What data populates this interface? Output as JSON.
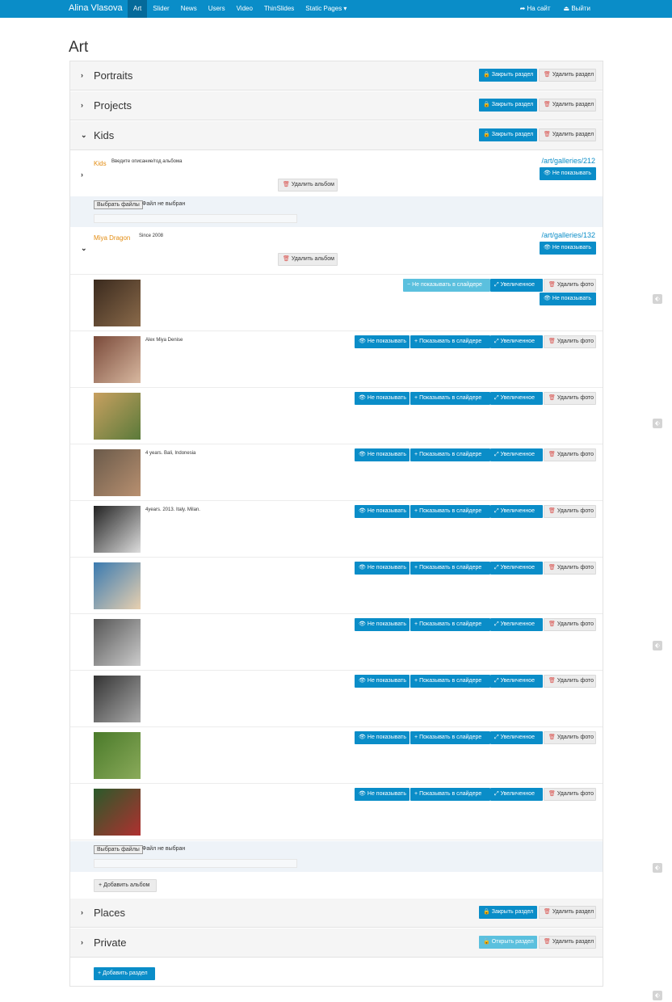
{
  "nav": {
    "brand": "Alina Vlasova",
    "items": [
      "Art",
      "Slider",
      "News",
      "Users",
      "Video",
      "ThinSlides",
      "Static Pages ▾"
    ],
    "right": [
      "➦ На сайт",
      "⏏ Выйти"
    ]
  },
  "page_title": "Art",
  "labels": {
    "close_section": "Закрыть раздел",
    "open_section": "Открыть раздел",
    "delete_section": "Удалить раздел",
    "delete_album": "Удалить альбом",
    "hide": "Не показывать",
    "show_in_slider": "Показывать в слайдере",
    "hide_in_slider": "Не показывать в слайдере",
    "enlarged": "Увеличенное",
    "delete_photo": "Удалить фото",
    "choose_files": "Выбрать файлы",
    "no_file": "Файл не выбран",
    "add_album": "Добавить альбом",
    "add_section": "Добавить раздел"
  },
  "sections": [
    {
      "title": "Portraits",
      "chev": "›"
    },
    {
      "title": "Projects",
      "chev": "›"
    },
    {
      "title": "Kids",
      "chev": "⌄"
    },
    {
      "title": "Places",
      "chev": "›"
    },
    {
      "title": "Private",
      "chev": "›"
    }
  ],
  "albums": [
    {
      "name": "Kids",
      "desc": "Введите описание/год альбома",
      "link": "/art/galleries/212"
    },
    {
      "name": "Miya Dragon",
      "desc": "Since 2008",
      "link": "/art/galleries/132"
    }
  ],
  "photos": [
    {
      "desc": "",
      "colors": [
        "#3a2a1e",
        "#8a6a4a"
      ]
    },
    {
      "desc": "Alex Miya Denise",
      "colors": [
        "#7a4a3a",
        "#d8b8a0"
      ]
    },
    {
      "desc": "",
      "colors": [
        "#c8a060",
        "#5a7a3a"
      ]
    },
    {
      "desc": "4 years. Bali, Indonesia",
      "colors": [
        "#6a5a4a",
        "#b89070"
      ]
    },
    {
      "desc": "4years. 2013. Italy. Milan.",
      "colors": [
        "#222222",
        "#dddddd"
      ]
    },
    {
      "desc": "",
      "colors": [
        "#3a7ab0",
        "#e8d0b0"
      ]
    },
    {
      "desc": "",
      "colors": [
        "#555555",
        "#cccccc"
      ]
    },
    {
      "desc": "",
      "colors": [
        "#333333",
        "#aaaaaa"
      ]
    },
    {
      "desc": "",
      "colors": [
        "#4a7a2a",
        "#8aaa5a"
      ]
    },
    {
      "desc": "",
      "colors": [
        "#2a5a2a",
        "#b03030"
      ]
    }
  ]
}
